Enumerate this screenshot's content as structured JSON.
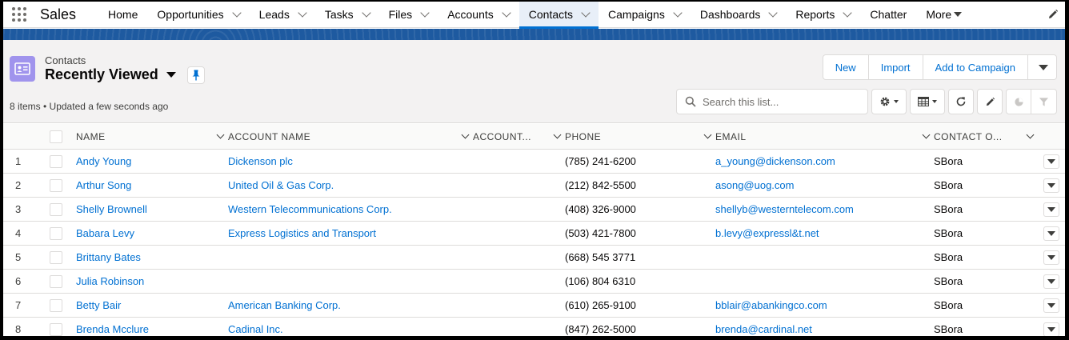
{
  "app": {
    "name": "Sales"
  },
  "nav": {
    "items": [
      {
        "label": "Home",
        "chevron": false,
        "active": false
      },
      {
        "label": "Opportunities",
        "chevron": true,
        "active": false
      },
      {
        "label": "Leads",
        "chevron": true,
        "active": false
      },
      {
        "label": "Tasks",
        "chevron": true,
        "active": false
      },
      {
        "label": "Files",
        "chevron": true,
        "active": false
      },
      {
        "label": "Accounts",
        "chevron": true,
        "active": false
      },
      {
        "label": "Contacts",
        "chevron": true,
        "active": true
      },
      {
        "label": "Campaigns",
        "chevron": true,
        "active": false
      },
      {
        "label": "Dashboards",
        "chevron": true,
        "active": false
      },
      {
        "label": "Reports",
        "chevron": true,
        "active": false
      },
      {
        "label": "Chatter",
        "chevron": false,
        "active": false
      }
    ],
    "more_label": "More"
  },
  "header": {
    "object_label": "Contacts",
    "list_name": "Recently Viewed",
    "meta": "8 items • Updated a few seconds ago",
    "buttons": {
      "new": "New",
      "import": "Import",
      "add_to_campaign": "Add to Campaign"
    },
    "search_placeholder": "Search this list..."
  },
  "table": {
    "columns": {
      "name": "NAME",
      "account_name": "ACCOUNT NAME",
      "account_other": "ACCOUNT...",
      "phone": "PHONE",
      "email": "EMAIL",
      "contact_owner": "CONTACT O..."
    },
    "rows": [
      {
        "num": "1",
        "name": "Andy Young",
        "account": "Dickenson plc",
        "phone": "(785) 241-6200",
        "email": "a_young@dickenson.com",
        "owner": "SBora"
      },
      {
        "num": "2",
        "name": "Arthur Song",
        "account": "United Oil & Gas Corp.",
        "phone": "(212) 842-5500",
        "email": "asong@uog.com",
        "owner": "SBora"
      },
      {
        "num": "3",
        "name": "Shelly Brownell",
        "account": "Western Telecommunications Corp.",
        "phone": "(408) 326-9000",
        "email": "shellyb@westerntelecom.com",
        "owner": "SBora"
      },
      {
        "num": "4",
        "name": "Babara Levy",
        "account": "Express Logistics and Transport",
        "phone": "(503) 421-7800",
        "email": "b.levy@expressl&t.net",
        "owner": "SBora"
      },
      {
        "num": "5",
        "name": "Brittany Bates",
        "account": "",
        "phone": "(668) 545 3771",
        "email": "",
        "owner": "SBora"
      },
      {
        "num": "6",
        "name": "Julia Robinson",
        "account": "",
        "phone": "(106) 804 6310",
        "email": "",
        "owner": "SBora"
      },
      {
        "num": "7",
        "name": "Betty Bair",
        "account": "American Banking Corp.",
        "phone": "(610) 265-9100",
        "email": "bblair@abankingco.com",
        "owner": "SBora"
      },
      {
        "num": "8",
        "name": "Brenda Mcclure",
        "account": "Cadinal Inc.",
        "phone": "(847) 262-5000",
        "email": "brenda@cardinal.net",
        "owner": "SBora"
      }
    ]
  },
  "colors": {
    "accent": "#0070d2",
    "band": "#1e5aa0",
    "object_icon": "#a094ed"
  },
  "icons": {
    "app_launcher": "waffle-icon",
    "edit_nav": "pencil-icon",
    "object": "contact-card-icon",
    "pin": "pin-icon",
    "search": "search-icon",
    "settings": "gear-icon",
    "display": "table-icon",
    "refresh": "refresh-icon",
    "edit": "pencil-icon",
    "chart": "chart-icon",
    "filter": "filter-icon"
  }
}
